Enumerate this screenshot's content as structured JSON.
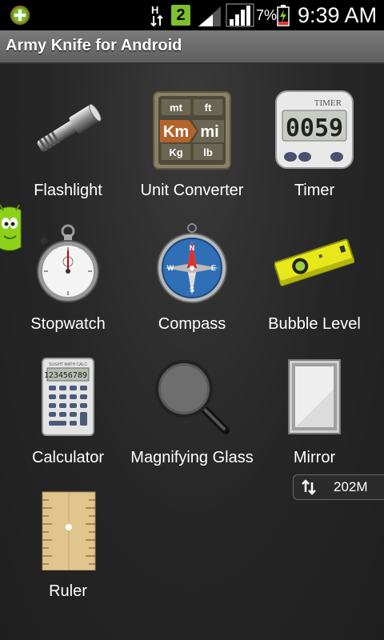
{
  "status": {
    "network_type": "H",
    "badge": "2",
    "battery_percent": "7%",
    "time": "9:39 AM"
  },
  "app_title": "Army Knife for Android",
  "tools": [
    {
      "label": "Flashlight",
      "icon": "flashlight-icon"
    },
    {
      "label": "Unit Converter",
      "icon": "unit-converter-icon",
      "icon_text": {
        "mt": "mt",
        "ft": "ft",
        "km": "Km",
        "mi": "mi",
        "kg": "Kg",
        "lb": "lb"
      }
    },
    {
      "label": "Timer",
      "icon": "timer-icon",
      "icon_text": {
        "brand": "TIMER",
        "display": "0059"
      }
    },
    {
      "label": "Stopwatch",
      "icon": "stopwatch-icon"
    },
    {
      "label": "Compass",
      "icon": "compass-icon",
      "icon_text": {
        "n": "N",
        "e": "E",
        "s": "S",
        "w": "W"
      }
    },
    {
      "label": "Bubble Level",
      "icon": "bubble-level-icon"
    },
    {
      "label": "Calculator",
      "icon": "calculator-icon",
      "icon_text": {
        "brand": "SLIGHT MATH CALC",
        "display": "123456789"
      }
    },
    {
      "label": "Magnifying Glass",
      "icon": "magnifying-glass-icon"
    },
    {
      "label": "Mirror",
      "icon": "mirror-icon"
    },
    {
      "label": "Ruler",
      "icon": "ruler-icon"
    }
  ],
  "memory_chip": {
    "value": "202M",
    "icon": "sync-arrows-icon"
  },
  "colors": {
    "title_bar": "#6b6b6b",
    "status_badge": "#7fbf2a",
    "android_green": "#8ed11a"
  }
}
